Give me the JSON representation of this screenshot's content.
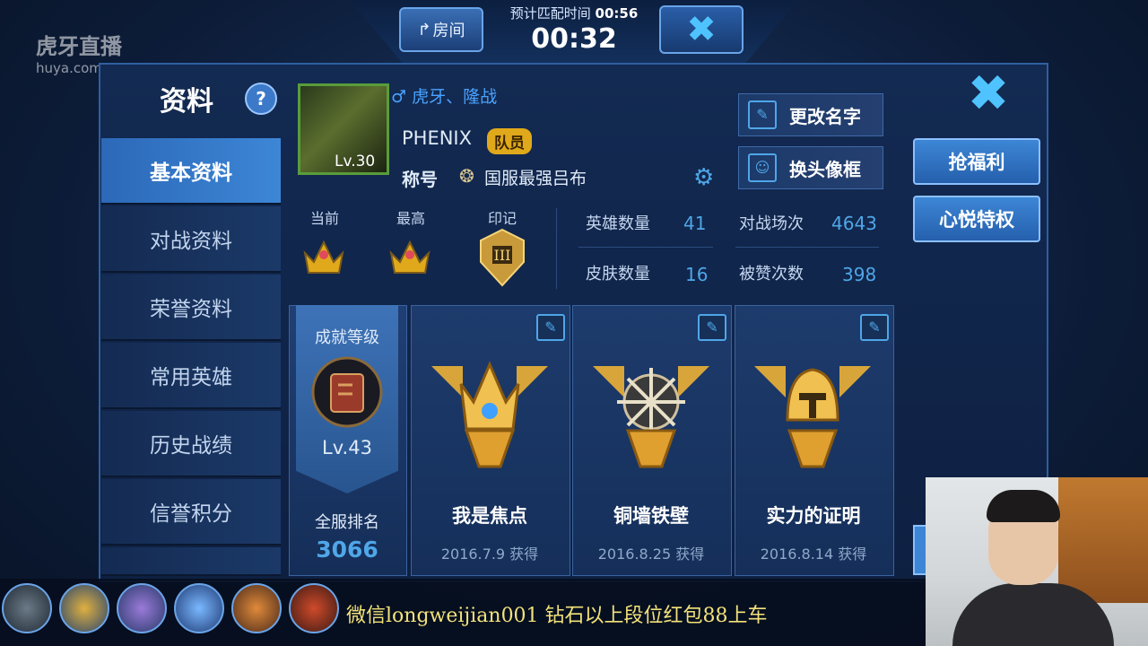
{
  "watermark": {
    "brand": "虎牙直播",
    "domain": "huya.com"
  },
  "top": {
    "room_label": "房间",
    "estimate_label": "预计匹配时间",
    "estimate_time": "00:56",
    "elapsed_time": "00:32"
  },
  "sidebar": {
    "title": "资料",
    "help": "?",
    "items": [
      {
        "label": "基本资料",
        "active": true
      },
      {
        "label": "对战资料",
        "active": false
      },
      {
        "label": "荣誉资料",
        "active": false
      },
      {
        "label": "常用英雄",
        "active": false
      },
      {
        "label": "历史战绩",
        "active": false
      },
      {
        "label": "信誉积分",
        "active": false
      }
    ]
  },
  "profile": {
    "gender_symbol": "♂",
    "guild": "虎牙、隆战",
    "name": "PHENIX",
    "role_badge": "队员",
    "level": "Lv.30",
    "title_label": "称号",
    "title_value": "国服最强吕布"
  },
  "actions": {
    "rename": "更改名字",
    "change_frame": "换头像框",
    "benefits": "抢福利",
    "privilege": "心悦特权"
  },
  "rank": {
    "current_label": "当前",
    "highest_label": "最高",
    "mark_label": "印记"
  },
  "stats": {
    "hero_count_label": "英雄数量",
    "hero_count": "41",
    "skin_count_label": "皮肤数量",
    "skin_count": "16",
    "battles_label": "对战场次",
    "battles": "4643",
    "likes_label": "被赞次数",
    "likes": "398"
  },
  "achievement_level": {
    "label": "成就等级",
    "level": "Lv.43",
    "rank_label": "全服排名",
    "rank_value": "3066"
  },
  "achievements": [
    {
      "name": "我是焦点",
      "date": "2016.7.9 获得"
    },
    {
      "name": "铜墙铁壁",
      "date": "2016.8.25 获得"
    },
    {
      "name": "实力的证明",
      "date": "2016.8.14 获得"
    }
  ],
  "ticker": "微信longweijian001   钻石以上段位红包88上车",
  "colors": {
    "accent": "#4fa6e8",
    "gold": "#e0a91b",
    "active_nav": "#3d86d6"
  }
}
